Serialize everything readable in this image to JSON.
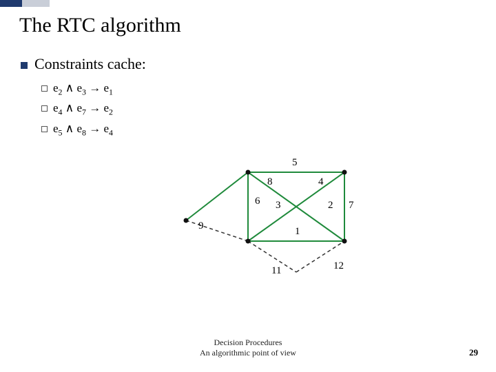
{
  "title": "The RTC algorithm",
  "bullet": "Constraints cache:",
  "constraints": [
    {
      "l1": "e",
      "l1s": "2",
      "l2": "e",
      "l2s": "3",
      "r": "e",
      "rs": "1"
    },
    {
      "l1": "e",
      "l1s": "4",
      "l2": "e",
      "l2s": "7",
      "r": "e",
      "rs": "2"
    },
    {
      "l1": "e",
      "l1s": "5",
      "l2": "e",
      "l2s": "8",
      "r": "e",
      "rs": "4"
    }
  ],
  "symbols": {
    "and": "∧",
    "implies": "→"
  },
  "edges": {
    "e1": "1",
    "e2": "2",
    "e3": "3",
    "e4": "4",
    "e5": "5",
    "e6": "6",
    "e7": "7",
    "e8": "8",
    "e9": "9",
    "e11": "11",
    "e12": "12"
  },
  "footer": {
    "line1": "Decision Procedures",
    "line2": "An algorithmic point of view"
  },
  "page": "29"
}
